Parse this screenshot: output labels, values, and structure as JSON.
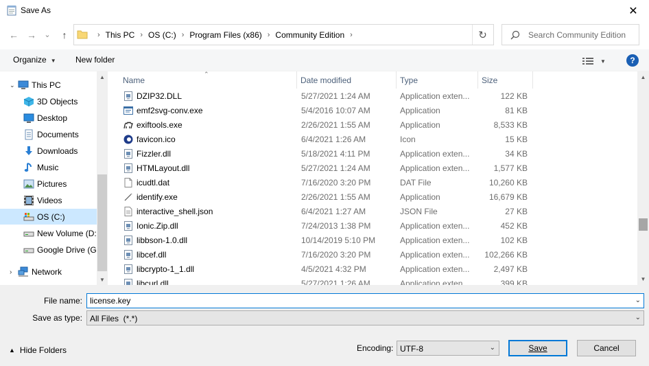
{
  "window": {
    "title": "Save As",
    "close_glyph": "✕"
  },
  "nav_buttons": {
    "back": "←",
    "forward": "→",
    "recent": "⌄",
    "up": "↑"
  },
  "address": {
    "crumbs": [
      "This PC",
      "OS (C:)",
      "Program Files (x86)",
      "Community Edition"
    ],
    "separator": "›",
    "dropdown": "⌄",
    "refresh": "↻"
  },
  "search": {
    "placeholder": "Search Community Edition"
  },
  "toolbar": {
    "organize": "Organize",
    "new_folder": "New folder",
    "help": "?"
  },
  "sidebar": {
    "items": [
      {
        "label": "This PC",
        "icon": "computer-icon"
      },
      {
        "label": "3D Objects",
        "icon": "3d-objects-icon"
      },
      {
        "label": "Desktop",
        "icon": "desktop-icon"
      },
      {
        "label": "Documents",
        "icon": "documents-icon"
      },
      {
        "label": "Downloads",
        "icon": "downloads-icon"
      },
      {
        "label": "Music",
        "icon": "music-icon"
      },
      {
        "label": "Pictures",
        "icon": "pictures-icon"
      },
      {
        "label": "Videos",
        "icon": "videos-icon"
      },
      {
        "label": "OS (C:)",
        "icon": "drive-icon",
        "selected": true
      },
      {
        "label": "New Volume (D:)",
        "icon": "drive-icon"
      },
      {
        "label": "Google Drive (G:)",
        "icon": "drive-icon"
      },
      {
        "label": "Network",
        "icon": "network-icon"
      }
    ]
  },
  "columns": {
    "name": "Name",
    "date": "Date modified",
    "type": "Type",
    "size": "Size"
  },
  "files": [
    {
      "name": "DZIP32.DLL",
      "date": "5/27/2021 1:24 AM",
      "type": "Application exten...",
      "size": "122 KB",
      "icon": "dll-icon"
    },
    {
      "name": "emf2svg-conv.exe",
      "date": "5/4/2016 10:07 AM",
      "type": "Application",
      "size": "81 KB",
      "icon": "exe-icon"
    },
    {
      "name": "exiftools.exe",
      "date": "2/26/2021 1:55 AM",
      "type": "Application",
      "size": "8,533 KB",
      "icon": "camel-icon"
    },
    {
      "name": "favicon.ico",
      "date": "6/4/2021 1:26 AM",
      "type": "Icon",
      "size": "15 KB",
      "icon": "ico-icon"
    },
    {
      "name": "Fizzler.dll",
      "date": "5/18/2021 4:11 PM",
      "type": "Application exten...",
      "size": "34 KB",
      "icon": "dll-icon"
    },
    {
      "name": "HTMLayout.dll",
      "date": "5/27/2021 1:24 AM",
      "type": "Application exten...",
      "size": "1,577 KB",
      "icon": "dll-icon"
    },
    {
      "name": "icudtl.dat",
      "date": "7/16/2020 3:20 PM",
      "type": "DAT File",
      "size": "10,260 KB",
      "icon": "file-icon"
    },
    {
      "name": "identify.exe",
      "date": "2/26/2021 1:55 AM",
      "type": "Application",
      "size": "16,679 KB",
      "icon": "wand-icon"
    },
    {
      "name": "interactive_shell.json",
      "date": "6/4/2021 1:27 AM",
      "type": "JSON File",
      "size": "27 KB",
      "icon": "json-file-icon"
    },
    {
      "name": "Ionic.Zip.dll",
      "date": "7/24/2013 1:38 PM",
      "type": "Application exten...",
      "size": "452 KB",
      "icon": "dll-icon"
    },
    {
      "name": "libbson-1.0.dll",
      "date": "10/14/2019 5:10 PM",
      "type": "Application exten...",
      "size": "102 KB",
      "icon": "dll-icon"
    },
    {
      "name": "libcef.dll",
      "date": "7/16/2020 3:20 PM",
      "type": "Application exten...",
      "size": "102,266 KB",
      "icon": "dll-icon"
    },
    {
      "name": "libcrypto-1_1.dll",
      "date": "4/5/2021 4:32 PM",
      "type": "Application exten...",
      "size": "2,497 KB",
      "icon": "dll-icon"
    },
    {
      "name": "libcurl.dll",
      "date": "5/27/2021 1:26 AM",
      "type": "Application exten...",
      "size": "399 KB",
      "icon": "dll-icon"
    }
  ],
  "form": {
    "file_name_label": "File name:",
    "file_name_value": "license.key",
    "save_type_label": "Save as type:",
    "save_type_value": "All Files  (*.*)",
    "encoding_label": "Encoding:",
    "encoding_value": "UTF-8",
    "hide_folders": "Hide Folders",
    "save_button": "Save",
    "cancel_button": "Cancel"
  },
  "colors": {
    "accent": "#0078d7",
    "selected_bg": "#cce8ff",
    "header_text": "#4c607a",
    "folder": "#f8d775"
  }
}
